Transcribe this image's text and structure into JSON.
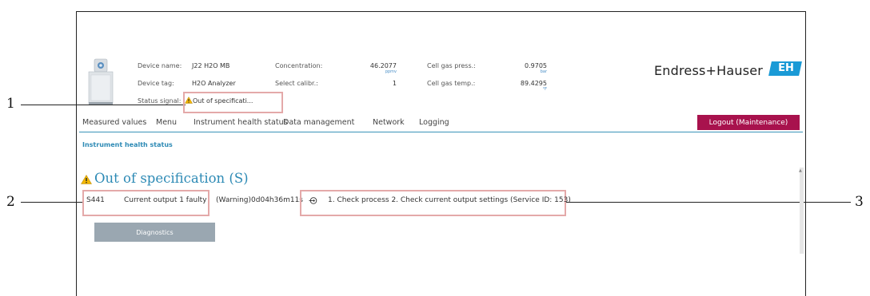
{
  "callouts": [
    "1",
    "2",
    "3"
  ],
  "header": {
    "device_name_label": "Device name:",
    "device_name_value": "J22 H2O MB",
    "device_tag_label": "Device tag:",
    "device_tag_value": "H2O Analyzer",
    "status_signal_label": "Status signal:",
    "status_signal_value": "Out of specificati...",
    "concentration_label": "Concentration:",
    "concentration_value": "46.2077",
    "concentration_unit": "ppmv",
    "select_calibr_label": "Select calibr.:",
    "select_calibr_value": "1",
    "cell_gas_press_label": "Cell gas press.:",
    "cell_gas_press_value": "0.9705",
    "cell_gas_press_unit": "bar",
    "cell_gas_temp_label": "Cell gas temp.:",
    "cell_gas_temp_value": "89.4295",
    "cell_gas_temp_unit": "°F",
    "brand": "Endress+Hauser",
    "brand_logo_text": "EH"
  },
  "nav": {
    "items": [
      "Measured values",
      "Menu",
      "Instrument health status",
      "Data management",
      "Network",
      "Logging"
    ],
    "logout_label": "Logout (Maintenance)"
  },
  "main": {
    "section_title": "Instrument health status",
    "category_title": "Out of specification (S)",
    "diag_code": "S441",
    "diag_text": "Current output 1 faulty",
    "diag_time": "(Warning)0d04h36m11s",
    "remedy": "1. Check process 2. Check current output settings (Service ID: 153)",
    "diagnostics_button": "Diagnostics"
  },
  "colors": {
    "accent": "#2d8ab5",
    "logout_bg": "#a8124d",
    "warning": "#f2b705",
    "highlight_box": "#e4a9a9",
    "brand_blue": "#1a9ad6"
  }
}
